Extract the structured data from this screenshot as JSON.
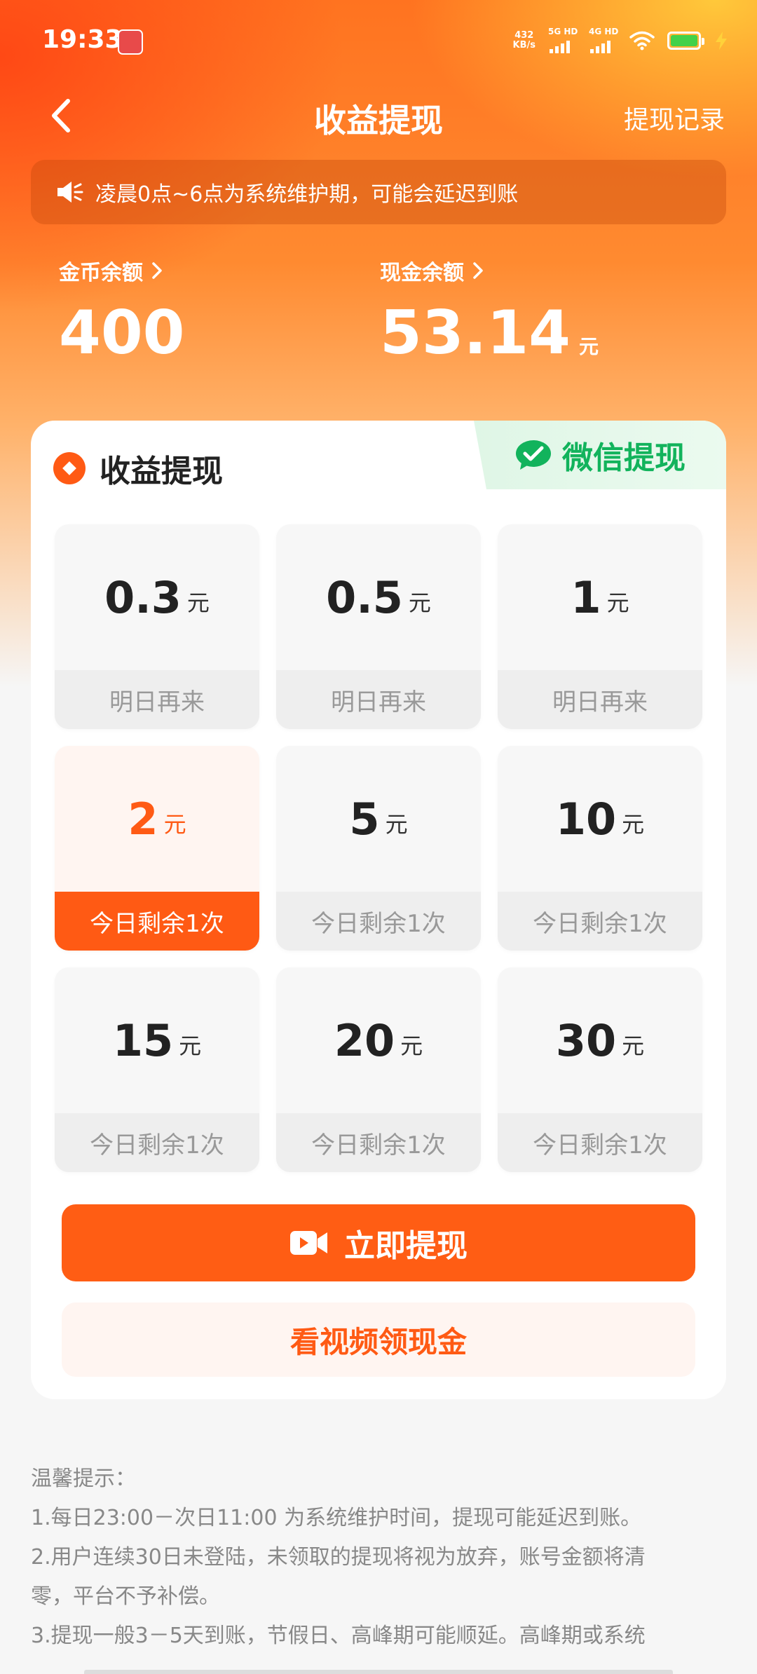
{
  "status_bar": {
    "time": "19:33",
    "net_speed_value": "432",
    "net_speed_unit": "KB/s",
    "signal_1_label": "5G HD",
    "signal_2_label": "4G HD",
    "battery_color": "#43d14a"
  },
  "nav": {
    "title": "收益提现",
    "history_link": "提现记录",
    "back_icon": "chevron-left-icon"
  },
  "notice": {
    "icon": "speaker-icon",
    "text": "凌晨0点~6点为系统维护期，可能会延迟到账"
  },
  "balances": {
    "coin": {
      "label": "金币余额",
      "value": "400"
    },
    "cash": {
      "label": "现金余额",
      "value": "53.14",
      "unit": "元"
    }
  },
  "card": {
    "title": "收益提现",
    "wechat_tab": "微信提现",
    "options": [
      {
        "amount": "0.3",
        "unit": "元",
        "status": "明日再来",
        "selected": false
      },
      {
        "amount": "0.5",
        "unit": "元",
        "status": "明日再来",
        "selected": false
      },
      {
        "amount": "1",
        "unit": "元",
        "status": "明日再来",
        "selected": false
      },
      {
        "amount": "2",
        "unit": "元",
        "status": "今日剩余1次",
        "selected": true
      },
      {
        "amount": "5",
        "unit": "元",
        "status": "今日剩余1次",
        "selected": false
      },
      {
        "amount": "10",
        "unit": "元",
        "status": "今日剩余1次",
        "selected": false
      },
      {
        "amount": "15",
        "unit": "元",
        "status": "今日剩余1次",
        "selected": false
      },
      {
        "amount": "20",
        "unit": "元",
        "status": "今日剩余1次",
        "selected": false
      },
      {
        "amount": "30",
        "unit": "元",
        "status": "今日剩余1次",
        "selected": false
      }
    ],
    "withdraw_button": "立即提现",
    "video_button": "看视频领现金"
  },
  "tips": {
    "heading": "温馨提示：",
    "items": [
      "1.每日23:00－次日11:00 为系统维护时间，提现可能延迟到账。",
      "2.用户连续30日未登陆，未领取的提现将视为放弃，账号金额将清",
      "零，平台不予补偿。",
      "3.提现一般3－5天到账，节假日、高峰期可能顺延。高峰期或系统"
    ]
  },
  "colors": {
    "accent": "#ff5a14",
    "wechat_green": "#12b35c"
  }
}
